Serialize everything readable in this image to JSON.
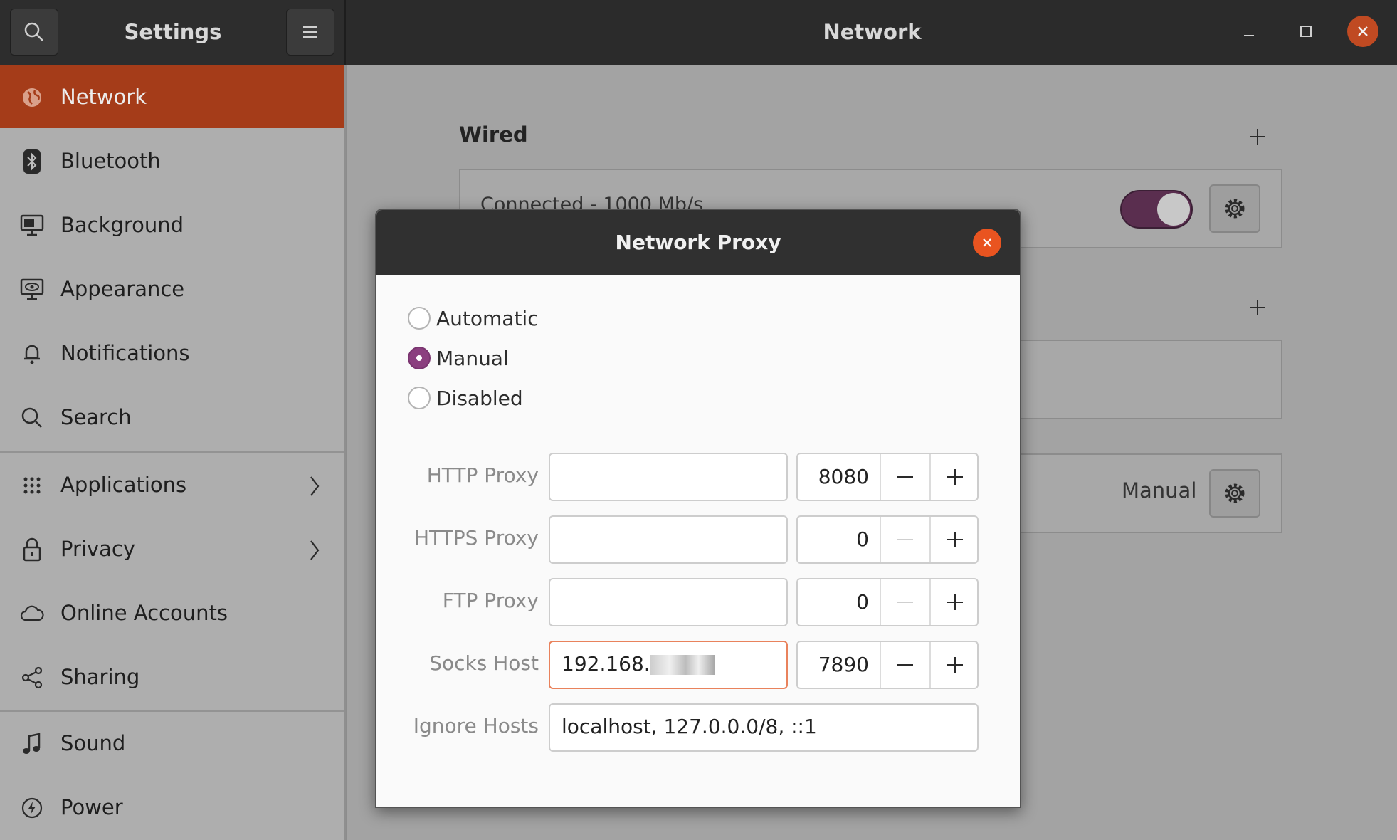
{
  "app": {
    "title": "Settings",
    "panel_title": "Network"
  },
  "sidebar": {
    "items": [
      {
        "label": "Network",
        "icon": "globe-icon"
      },
      {
        "label": "Bluetooth",
        "icon": "bluetooth-icon"
      },
      {
        "label": "Background",
        "icon": "monitor-icon"
      },
      {
        "label": "Appearance",
        "icon": "appearance-icon"
      },
      {
        "label": "Notifications",
        "icon": "bell-icon"
      },
      {
        "label": "Search",
        "icon": "search-icon"
      },
      {
        "label": "Applications",
        "icon": "grid-icon"
      },
      {
        "label": "Privacy",
        "icon": "lock-icon"
      },
      {
        "label": "Online Accounts",
        "icon": "cloud-icon"
      },
      {
        "label": "Sharing",
        "icon": "share-icon"
      },
      {
        "label": "Sound",
        "icon": "music-note-icon"
      },
      {
        "label": "Power",
        "icon": "power-icon"
      }
    ]
  },
  "main": {
    "wired_title": "Wired",
    "wired_status": "Connected - 1000 Mb/s",
    "proxy_mode": "Manual"
  },
  "dialog": {
    "title": "Network Proxy",
    "modes": [
      {
        "label": "Automatic",
        "checked": false
      },
      {
        "label": "Manual",
        "checked": true
      },
      {
        "label": "Disabled",
        "checked": false
      }
    ],
    "fields": {
      "http": {
        "label": "HTTP Proxy",
        "host": "",
        "port": "8080"
      },
      "https": {
        "label": "HTTPS Proxy",
        "host": "",
        "port": "0"
      },
      "ftp": {
        "label": "FTP Proxy",
        "host": "",
        "port": "0"
      },
      "socks": {
        "label": "Socks Host",
        "host": "192.168.",
        "port": "7890"
      },
      "ignore": {
        "label": "Ignore Hosts",
        "value": "localhost, 127.0.0.0/8, ::1"
      }
    }
  },
  "colors": {
    "accent": "#e95420",
    "active_sidebar": "#a53c19",
    "radio_checked": "#8b3f7f",
    "toggle_on": "#5a2e4f"
  }
}
